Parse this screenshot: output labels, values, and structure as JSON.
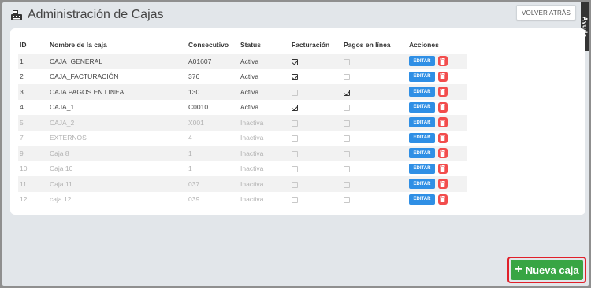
{
  "header": {
    "title": "Administración de Cajas",
    "back_label": "VOLVER ATRÁS",
    "help_label": "Ayuda"
  },
  "table": {
    "columns": [
      "ID",
      "Nombre de la caja",
      "Consecutivo",
      "Status",
      "Facturación",
      "Pagos en línea",
      "Acciones"
    ],
    "rows": [
      {
        "id": "1",
        "name": "CAJA_GENERAL",
        "consecutivo": "A01607",
        "status": "Activa",
        "facturacion": true,
        "pagos": false,
        "active": true
      },
      {
        "id": "2",
        "name": "CAJA_FACTURACIÓN",
        "consecutivo": "376",
        "status": "Activa",
        "facturacion": true,
        "pagos": false,
        "active": true
      },
      {
        "id": "3",
        "name": "CAJA PAGOS EN LINEA",
        "consecutivo": "130",
        "status": "Activa",
        "facturacion": false,
        "pagos": true,
        "active": true
      },
      {
        "id": "4",
        "name": "CAJA_1",
        "consecutivo": "C0010",
        "status": "Activa",
        "facturacion": true,
        "pagos": false,
        "active": true
      },
      {
        "id": "5",
        "name": "CAJA_2",
        "consecutivo": "X001",
        "status": "Inactiva",
        "facturacion": false,
        "pagos": false,
        "active": false
      },
      {
        "id": "7",
        "name": "EXTERNOS",
        "consecutivo": "4",
        "status": "Inactiva",
        "facturacion": false,
        "pagos": false,
        "active": false
      },
      {
        "id": "9",
        "name": "Caja 8",
        "consecutivo": "1",
        "status": "Inactiva",
        "facturacion": false,
        "pagos": false,
        "active": false
      },
      {
        "id": "10",
        "name": "Caja 10",
        "consecutivo": "1",
        "status": "Inactiva",
        "facturacion": false,
        "pagos": false,
        "active": false
      },
      {
        "id": "11",
        "name": "Caja 11",
        "consecutivo": "037",
        "status": "Inactiva",
        "facturacion": false,
        "pagos": false,
        "active": false
      },
      {
        "id": "12",
        "name": "caja 12",
        "consecutivo": "039",
        "status": "Inactiva",
        "facturacion": false,
        "pagos": false,
        "active": false
      }
    ],
    "edit_label": "EDITAR"
  },
  "new_button": {
    "label": "Nueva caja",
    "icon": "plus-icon"
  },
  "colors": {
    "edit": "#2f8fe5",
    "delete": "#f24d4d",
    "new": "#38a544",
    "highlight": "#e0202a"
  }
}
